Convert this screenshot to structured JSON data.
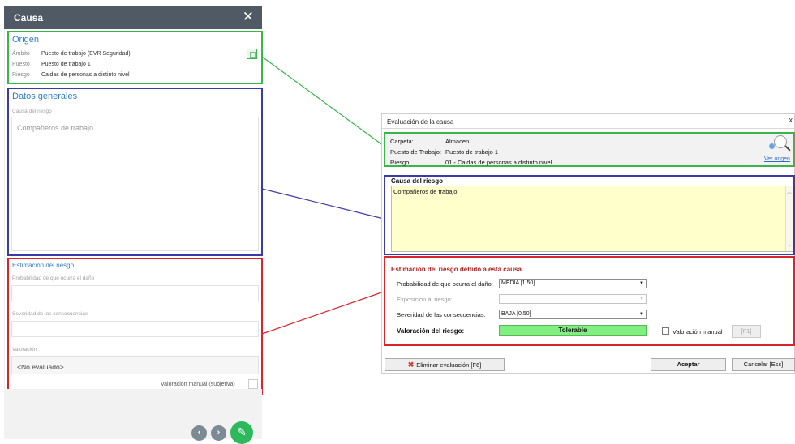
{
  "mobile": {
    "header_title": "Causa",
    "close_glyph": "✕",
    "origen": {
      "title": "Origen",
      "rows": [
        {
          "label": "Ámbito",
          "value": "Puesto de trabajo (EVR Seguridad)"
        },
        {
          "label": "Puesto",
          "value": "Puesto de trabajo 1"
        },
        {
          "label": "Riesgo",
          "value": "Caidas de personas a distinto nivel"
        }
      ]
    },
    "datos": {
      "title": "Datos generales",
      "causa_label": "Causa del riesgo",
      "causa_placeholder": "Compañeros de trabajo."
    },
    "estimacion": {
      "title": "Estimación del riesgo",
      "prob_label": "Probabilidad de que ocurra el daño",
      "sev_label": "Severidad de las consecuencias",
      "val_label": "Valoración",
      "val_value": "<No evaluado>",
      "manual_label": "Valoración manual (subjetiva)"
    },
    "footer": {
      "prev_glyph": "‹",
      "next_glyph": "›",
      "edit_glyph": "✎"
    }
  },
  "desktop": {
    "title": "Evaluación de la causa",
    "close_glyph": "x",
    "info": {
      "rows": [
        {
          "label": "Carpeta:",
          "value": "Almacen"
        },
        {
          "label": "Puesto de Trabajo:",
          "value": "Puesto de trabajo 1"
        },
        {
          "label": "Riesgo:",
          "value": "01 - Caidas de personas a distinto nivel"
        }
      ],
      "ver_origen": "Ver origen"
    },
    "causa": {
      "title": "Causa del riesgo",
      "value": "Compañeros de trabajo."
    },
    "estimacion": {
      "title": "Estimación del riesgo debido a esta causa",
      "prob_label": "Probabilidad de que ocurra el daño:",
      "prob_value": "MEDIA  [1.50]",
      "expo_label": "Exposición al riesgo:",
      "expo_value": "",
      "sev_label": "Severidad de las consecuencias:",
      "sev_value": "BAJA  [0.50]",
      "val_label": "Valoración del riesgo:",
      "val_value": "Tolerable",
      "manual_label": "Valoración manual",
      "f1_label": "[F1]"
    },
    "buttons": {
      "eliminar": "Eliminar evaluación [F6]",
      "aceptar": "Aceptar",
      "cancelar": "Cancelar [Esc]"
    }
  },
  "colors": {
    "green": "#39b54a",
    "blue": "#3a3aa8",
    "red": "#d9252a",
    "tolerable": "#80ee80"
  }
}
